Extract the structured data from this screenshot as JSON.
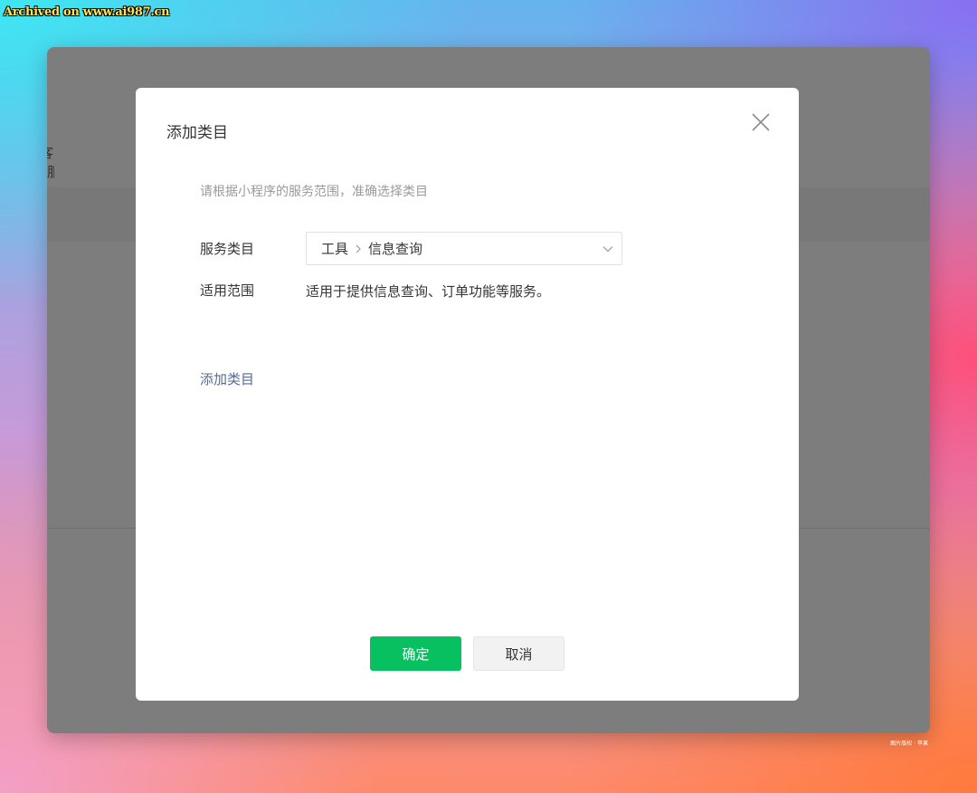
{
  "watermark": "Archived on www.ai987.cn",
  "background": {
    "side_label": "客服",
    "credit": "图片版权 · 苹果"
  },
  "modal": {
    "title": "添加类目",
    "close_icon": "close-icon",
    "hint": "请根据小程序的服务范围，准确选择类目",
    "service_category": {
      "label": "服务类目",
      "path": [
        "工具",
        "信息查询"
      ],
      "separator_icon": "chevron-right-icon",
      "dropdown_icon": "chevron-down-icon"
    },
    "scope": {
      "label": "适用范围",
      "value": "适用于提供信息查询、订单功能等服务。"
    },
    "add_category_link": "添加类目",
    "buttons": {
      "confirm": "确定",
      "cancel": "取消"
    }
  },
  "colors": {
    "primary": "#07c160",
    "link": "#576b95",
    "overlay": "#7d7d7d"
  }
}
